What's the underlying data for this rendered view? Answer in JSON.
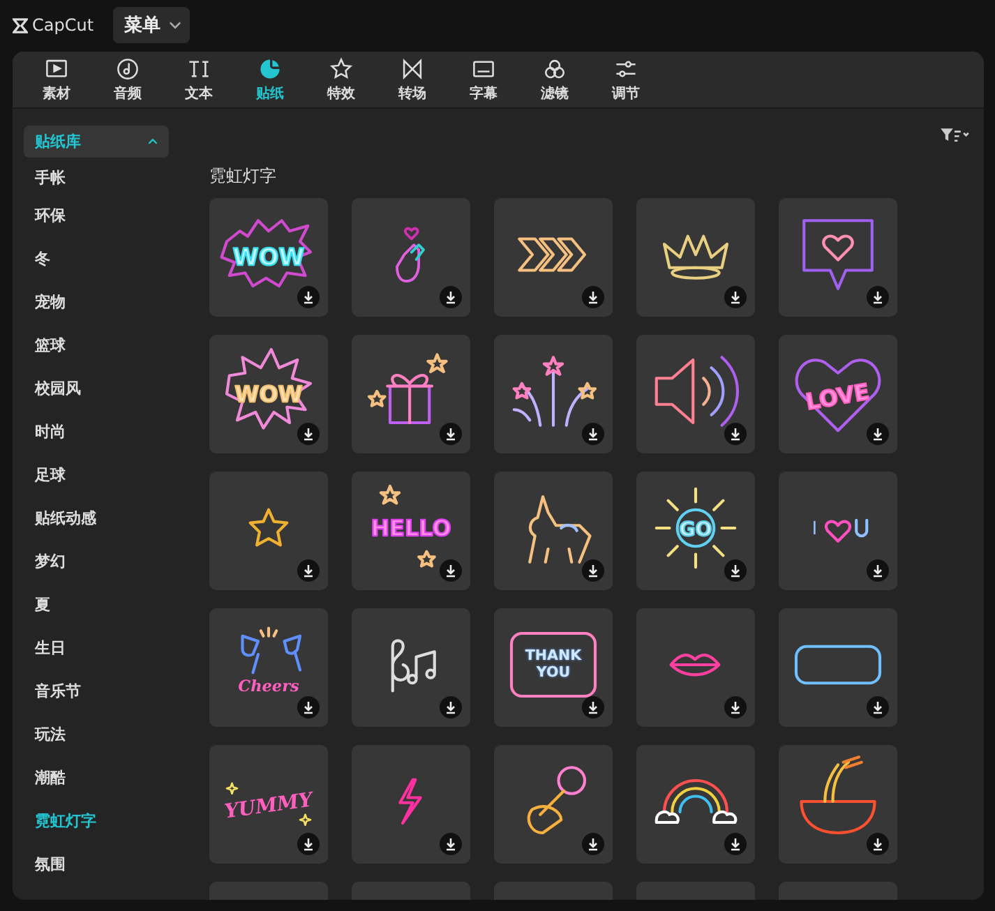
{
  "app": {
    "logo": "CapCut",
    "menu": "菜单"
  },
  "tabs": [
    {
      "label": "素材",
      "selected": false
    },
    {
      "label": "音频",
      "selected": false
    },
    {
      "label": "文本",
      "selected": false
    },
    {
      "label": "贴纸",
      "selected": true
    },
    {
      "label": "特效",
      "selected": false
    },
    {
      "label": "转场",
      "selected": false
    },
    {
      "label": "字幕",
      "selected": false
    },
    {
      "label": "滤镜",
      "selected": false
    },
    {
      "label": "调节",
      "selected": false
    }
  ],
  "sidebar": {
    "header": {
      "label": "贴纸库",
      "expanded": true
    },
    "items": [
      {
        "label": "手帐",
        "selected": false
      },
      {
        "label": "环保",
        "selected": false
      },
      {
        "label": "冬",
        "selected": false
      },
      {
        "label": "宠物",
        "selected": false
      },
      {
        "label": "篮球",
        "selected": false
      },
      {
        "label": "校园风",
        "selected": false
      },
      {
        "label": "时尚",
        "selected": false
      },
      {
        "label": "足球",
        "selected": false
      },
      {
        "label": "贴纸动感",
        "selected": false
      },
      {
        "label": "梦幻",
        "selected": false
      },
      {
        "label": "夏",
        "selected": false
      },
      {
        "label": "生日",
        "selected": false
      },
      {
        "label": "音乐节",
        "selected": false
      },
      {
        "label": "玩法",
        "selected": false
      },
      {
        "label": "潮酷",
        "selected": false
      },
      {
        "label": "霓虹灯字",
        "selected": true
      },
      {
        "label": "氛围",
        "selected": false
      }
    ]
  },
  "section": {
    "title": "霓虹灯字",
    "stickers": [
      {
        "kind": "burst",
        "text": "WOW"
      },
      {
        "kind": "hand"
      },
      {
        "kind": "chevrons"
      },
      {
        "kind": "crown"
      },
      {
        "kind": "bubble"
      },
      {
        "kind": "burst2",
        "text": "WOW"
      },
      {
        "kind": "gift"
      },
      {
        "kind": "fireworks"
      },
      {
        "kind": "speaker"
      },
      {
        "kind": "heart",
        "text": "LOVE"
      },
      {
        "kind": "star"
      },
      {
        "kind": "word",
        "text": "HELLO"
      },
      {
        "kind": "unicorn"
      },
      {
        "kind": "sun",
        "text": "GO"
      },
      {
        "kind": "iloveu",
        "text": "I"
      },
      {
        "kind": "glasses",
        "text": "Cheers"
      },
      {
        "kind": "notes"
      },
      {
        "kind": "sign",
        "text": "THANK YOU"
      },
      {
        "kind": "lips"
      },
      {
        "kind": "frame"
      },
      {
        "kind": "yummy",
        "text": "YUMMY"
      },
      {
        "kind": "bolt"
      },
      {
        "kind": "mic"
      },
      {
        "kind": "rainbow"
      },
      {
        "kind": "bowl"
      },
      {
        "kind": "blank"
      },
      {
        "kind": "blank"
      },
      {
        "kind": "blank"
      },
      {
        "kind": "blank"
      },
      {
        "kind": "blank"
      }
    ]
  }
}
